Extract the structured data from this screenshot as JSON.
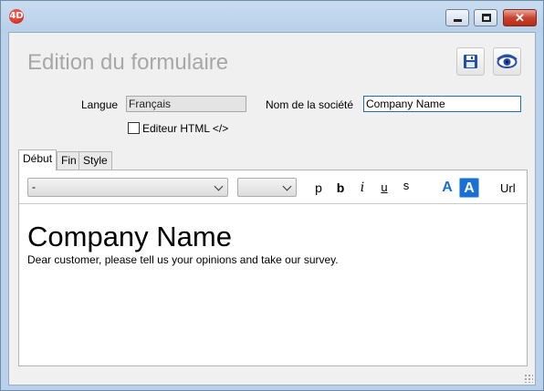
{
  "window": {
    "app_icon_text": "4D",
    "controls": {
      "minimize": "minimize",
      "maximize": "maximize",
      "close": "✕"
    }
  },
  "header": {
    "title": "Edition du formulaire",
    "save_icon": "floppy-disk-icon",
    "preview_icon": "eye-icon"
  },
  "form": {
    "language_label": "Langue",
    "language_value": "Français",
    "company_label": "Nom de la société",
    "company_value": "Company Name",
    "html_editor_label": "Editeur HTML </>",
    "html_editor_checked": false
  },
  "tabs": [
    {
      "label": "Début",
      "active": true
    },
    {
      "label": "Fin",
      "active": false
    },
    {
      "label": "Style",
      "active": false
    }
  ],
  "toolbar": {
    "style_select_value": "-",
    "size_select_value": "",
    "format_buttons": [
      "p",
      "b",
      "i",
      "u",
      "s"
    ],
    "font_color_label": "A",
    "highlight_label": "A",
    "url_label": "Url",
    "accent_color": "#1c6fd2"
  },
  "editor": {
    "heading": "Company Name",
    "body": "Dear customer, please tell us your opinions and take our survey."
  }
}
